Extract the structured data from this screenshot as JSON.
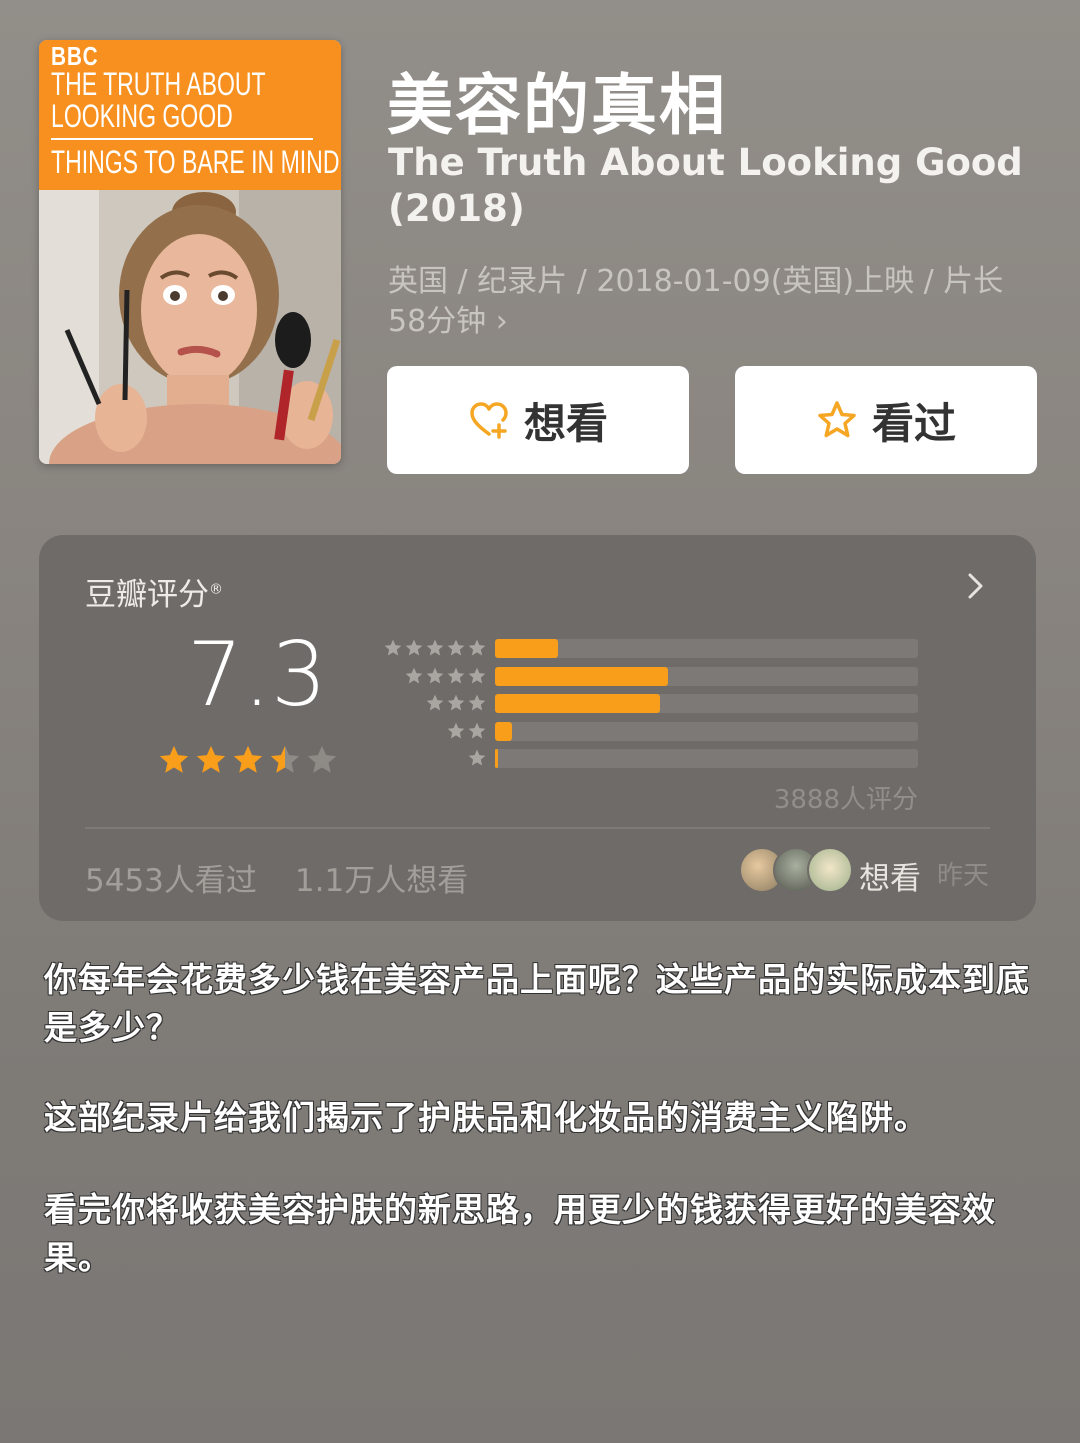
{
  "poster": {
    "brand": "BBC",
    "line1": "THE TRUTH ABOUT",
    "line2": "LOOKING GOOD",
    "line3": "THINGS TO BARE IN MIND"
  },
  "movie": {
    "title_cn": "美容的真相",
    "title_en": "The Truth About Looking Good (2018)",
    "meta": "英国 / 纪录片 / 2018-01-09(英国)上映 / 片长58分钟 ›"
  },
  "actions": {
    "want_label": "想看",
    "seen_label": "看过"
  },
  "rating": {
    "title": "豆瓣评分",
    "mark": "®",
    "score": "7.3",
    "score_stars": 3.5,
    "max_stars": 5,
    "count_label": "3888人评分",
    "distribution": [
      {
        "stars": 5,
        "percent": 15
      },
      {
        "stars": 4,
        "percent": 41
      },
      {
        "stars": 3,
        "percent": 39
      },
      {
        "stars": 2,
        "percent": 4
      },
      {
        "stars": 1,
        "percent": 1
      }
    ],
    "seen_count": "5453人看过",
    "want_count": "1.1万人想看",
    "friends_action": "想看",
    "friends_time": "昨天"
  },
  "description": {
    "p1": "你每年会花费多少钱在美容产品上面呢？这些产品的实际成本到底是多少？",
    "p2": "这部纪录片给我们揭示了护肤品和化妆品的消费主义陷阱。",
    "p3": "看完你将收获美容护肤的新思路，用更少的钱获得更好的美容效果。"
  },
  "colors": {
    "accent": "#f99e1b",
    "poster_orange": "#f7901e"
  }
}
